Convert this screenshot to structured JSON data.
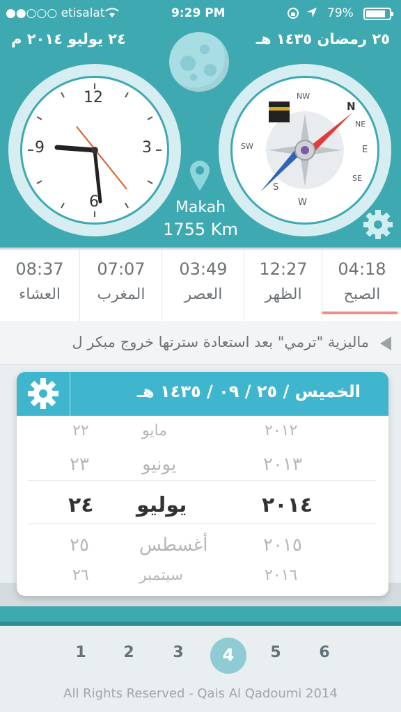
{
  "status_bar": {
    "carrier": "●●○○○ etisalat",
    "time": "9:29 PM",
    "battery": "79%"
  },
  "header": {
    "gregorian_date": "٢٤ يوليو ٢٠١٤ م",
    "hijri_date": "٢٥ رمضان ١٤٣٥ هـ"
  },
  "clock": {
    "numbers": [
      "12",
      "3",
      "6",
      "9"
    ]
  },
  "compass": {
    "labels": [
      "N",
      "NE",
      "E",
      "SE",
      "S",
      "SW",
      "W",
      "NW"
    ]
  },
  "location": {
    "city": "Makah",
    "distance": "1755 Km"
  },
  "prayers": [
    {
      "time": "08:37",
      "name": "العشاء"
    },
    {
      "time": "07:07",
      "name": "المغرب"
    },
    {
      "time": "03:49",
      "name": "العصر"
    },
    {
      "time": "12:27",
      "name": "الظهر"
    },
    {
      "time": "04:18",
      "name": "الصبح"
    }
  ],
  "ticker": {
    "text": "ماليزية \"ترمي\" بعد استعادة سترتها     خروج مبكر ل"
  },
  "converter": {
    "hijri_header": "الخميس / ٢٥ / ٠٩ / ١٤٣٥ هـ",
    "rows": [
      {
        "day": "٢٢",
        "month": "مايو",
        "year": "٢٠١٢"
      },
      {
        "day": "٢٣",
        "month": "يونيو",
        "year": "٢٠١٣"
      },
      {
        "day": "٢٤",
        "month": "يوليو",
        "year": "٢٠١٤"
      },
      {
        "day": "٢٥",
        "month": "أغسطس",
        "year": "٢٠١٥"
      },
      {
        "day": "٢٦",
        "month": "سبتمبر",
        "year": "٢٠١٦"
      }
    ]
  },
  "pager": {
    "pages": [
      "1",
      "2",
      "3",
      "4",
      "5",
      "6"
    ],
    "active": "4"
  },
  "footer": {
    "copyright": "All Rights Reserved - Qais Al Qadoumi 2014"
  },
  "colors": {
    "teal": "#3fa9b1",
    "header_blue": "#3fb6cd",
    "active_underline": "#f28a8a"
  }
}
